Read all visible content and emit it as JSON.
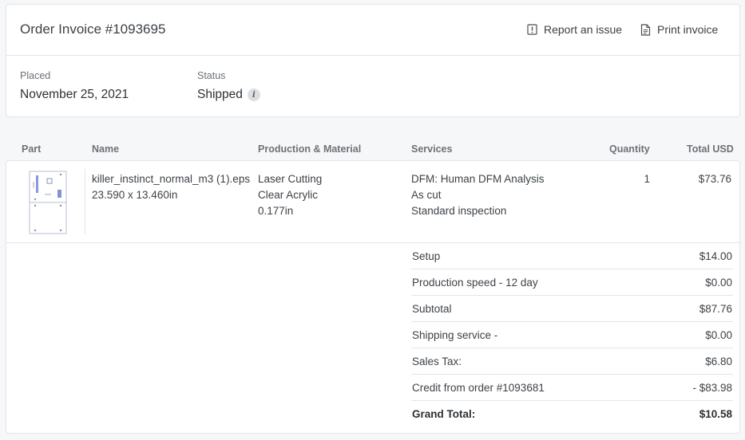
{
  "header": {
    "title": "Order Invoice #1093695",
    "actions": {
      "report_label": "Report an issue",
      "print_label": "Print invoice"
    }
  },
  "meta": {
    "placed_label": "Placed",
    "placed_value": "November 25, 2021",
    "status_label": "Status",
    "status_value": "Shipped",
    "status_info_glyph": "i"
  },
  "columns": {
    "part": "Part",
    "name": "Name",
    "production": "Production & Material",
    "services": "Services",
    "quantity": "Quantity",
    "total": "Total USD"
  },
  "items": [
    {
      "name": "killer_instinct_normal_m3 (1).eps",
      "dimensions": "23.590 x 13.460in",
      "production": [
        "Laser Cutting",
        "Clear Acrylic",
        "0.177in"
      ],
      "services": [
        "DFM: Human DFM Analysis",
        "As cut",
        "Standard inspection"
      ],
      "quantity": "1",
      "total": "$73.76"
    }
  ],
  "summary": [
    {
      "label": "Setup",
      "value": "$14.00"
    },
    {
      "label": "Production speed - 12 day",
      "value": "$0.00"
    },
    {
      "label": "Subtotal",
      "value": "$87.76"
    },
    {
      "label": "Shipping service -",
      "value": "$0.00"
    },
    {
      "label": "Sales Tax:",
      "value": "$6.80"
    },
    {
      "label": "Credit from order #1093681",
      "value": "- $83.98"
    },
    {
      "label": "Grand Total:",
      "value": "$10.58"
    }
  ],
  "icons": {
    "report": "report-issue-icon",
    "print": "document-icon",
    "info": "info-icon"
  },
  "colors": {
    "text": "#3d4247",
    "muted": "#6c7278",
    "border": "#e2e5e8",
    "background": "#f6f7f8",
    "part_preview_blue": "#6b7fd6"
  }
}
